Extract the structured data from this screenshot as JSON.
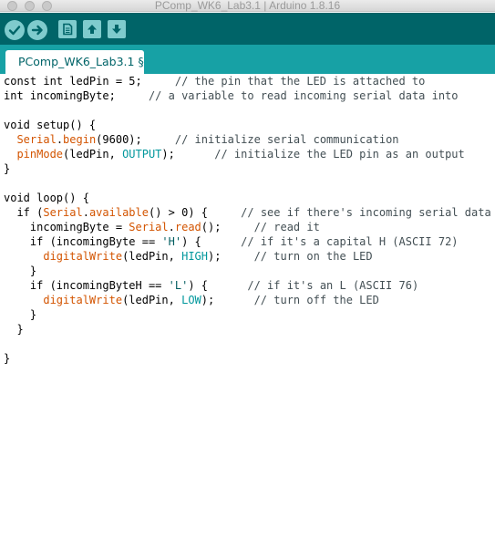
{
  "window": {
    "title": "PComp_WK6_Lab3.1 | Arduino 1.8.16"
  },
  "toolbar": {
    "buttons": [
      {
        "name": "verify",
        "icon": "checkmark-icon"
      },
      {
        "name": "upload",
        "icon": "arrow-right-icon"
      },
      {
        "name": "new",
        "icon": "document-icon"
      },
      {
        "name": "open",
        "icon": "arrow-up-icon"
      },
      {
        "name": "save",
        "icon": "arrow-down-icon"
      }
    ]
  },
  "tabs": [
    {
      "label": "PComp_WK6_Lab3.1 §"
    }
  ],
  "colors": {
    "toolbar": "#006468",
    "tabstrip": "#17a1a5",
    "keyword": "#00979c",
    "function": "#d35400"
  },
  "code": {
    "lines": [
      [
        {
          "t": "const int ledPin = 5;     ",
          "c": ""
        },
        {
          "t": "// the pin that the LED is attached to",
          "c": "cm"
        }
      ],
      [
        {
          "t": "int incomingByte;     ",
          "c": ""
        },
        {
          "t": "// a variable to read incoming serial data into",
          "c": "cm"
        }
      ],
      [
        {
          "t": "",
          "c": ""
        }
      ],
      [
        {
          "t": "void setup() {",
          "c": ""
        }
      ],
      [
        {
          "t": "  ",
          "c": ""
        },
        {
          "t": "Serial",
          "c": "fn"
        },
        {
          "t": ".",
          "c": ""
        },
        {
          "t": "begin",
          "c": "fn"
        },
        {
          "t": "(9600);     ",
          "c": ""
        },
        {
          "t": "// initialize serial communication",
          "c": "cm"
        }
      ],
      [
        {
          "t": "  ",
          "c": ""
        },
        {
          "t": "pinMode",
          "c": "fn"
        },
        {
          "t": "(ledPin, ",
          "c": ""
        },
        {
          "t": "OUTPUT",
          "c": "kw"
        },
        {
          "t": ");      ",
          "c": ""
        },
        {
          "t": "// initialize the LED pin as an output",
          "c": "cm"
        }
      ],
      [
        {
          "t": "}",
          "c": ""
        }
      ],
      [
        {
          "t": "",
          "c": ""
        }
      ],
      [
        {
          "t": "void loop() {",
          "c": ""
        }
      ],
      [
        {
          "t": "  if (",
          "c": ""
        },
        {
          "t": "Serial",
          "c": "fn"
        },
        {
          "t": ".",
          "c": ""
        },
        {
          "t": "available",
          "c": "fn"
        },
        {
          "t": "() > 0) {     ",
          "c": ""
        },
        {
          "t": "// see if there's incoming serial data",
          "c": "cm"
        }
      ],
      [
        {
          "t": "    incomingByte = ",
          "c": ""
        },
        {
          "t": "Serial",
          "c": "fn"
        },
        {
          "t": ".",
          "c": ""
        },
        {
          "t": "read",
          "c": "fn"
        },
        {
          "t": "();     ",
          "c": ""
        },
        {
          "t": "// read it",
          "c": "cm"
        }
      ],
      [
        {
          "t": "    if (incomingByte == ",
          "c": ""
        },
        {
          "t": "'H'",
          "c": "str"
        },
        {
          "t": ") {      ",
          "c": ""
        },
        {
          "t": "// if it's a capital H (ASCII 72)",
          "c": "cm"
        }
      ],
      [
        {
          "t": "      ",
          "c": ""
        },
        {
          "t": "digitalWrite",
          "c": "fn"
        },
        {
          "t": "(ledPin, ",
          "c": ""
        },
        {
          "t": "HIGH",
          "c": "kw"
        },
        {
          "t": ");     ",
          "c": ""
        },
        {
          "t": "// turn on the LED",
          "c": "cm"
        }
      ],
      [
        {
          "t": "    }",
          "c": ""
        }
      ],
      [
        {
          "t": "    if (incomingByteH == ",
          "c": ""
        },
        {
          "t": "'L'",
          "c": "str"
        },
        {
          "t": ") {      ",
          "c": ""
        },
        {
          "t": "// if it's an L (ASCII 76)",
          "c": "cm"
        }
      ],
      [
        {
          "t": "      ",
          "c": ""
        },
        {
          "t": "digitalWrite",
          "c": "fn"
        },
        {
          "t": "(ledPin, ",
          "c": ""
        },
        {
          "t": "LOW",
          "c": "kw"
        },
        {
          "t": ");      ",
          "c": ""
        },
        {
          "t": "// turn off the LED",
          "c": "cm"
        }
      ],
      [
        {
          "t": "    }",
          "c": ""
        }
      ],
      [
        {
          "t": "  }",
          "c": ""
        }
      ],
      [
        {
          "t": "",
          "c": ""
        }
      ],
      [
        {
          "t": "}",
          "c": ""
        }
      ]
    ]
  }
}
